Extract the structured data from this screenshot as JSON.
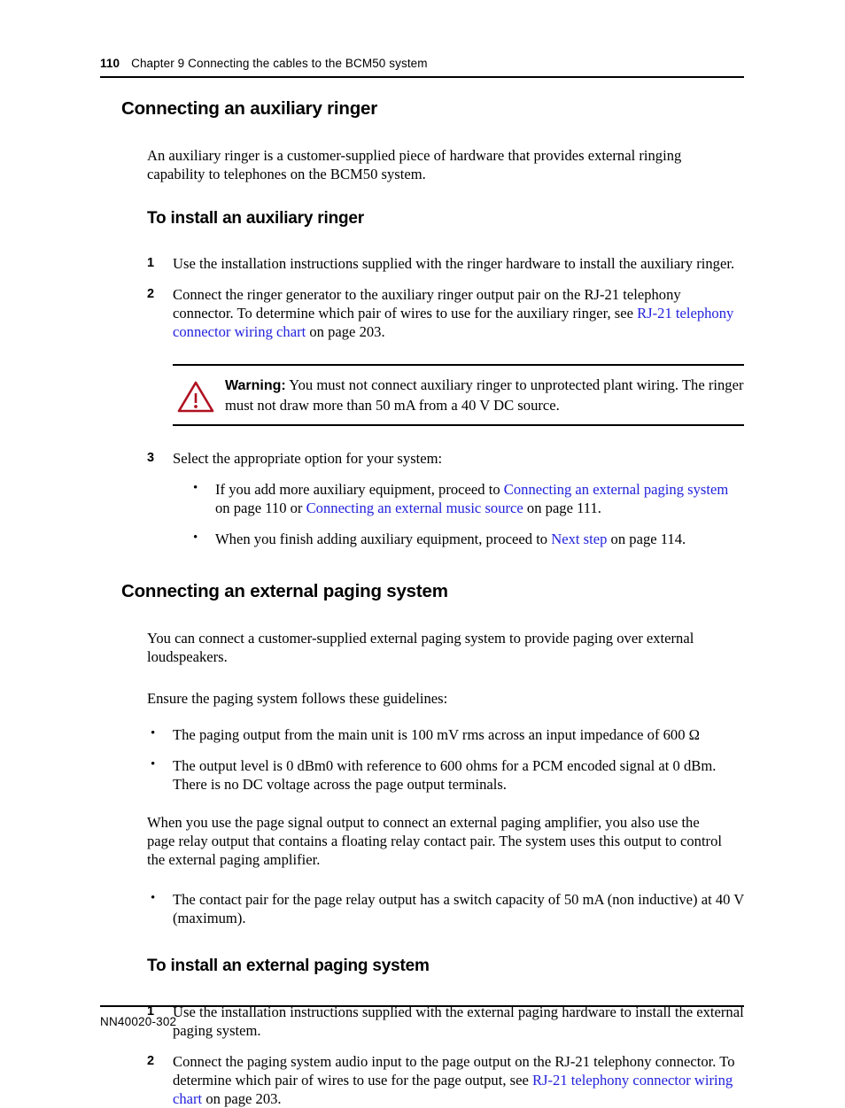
{
  "header": {
    "page_number": "110",
    "chapter_text": "Chapter 9  Connecting the cables to the BCM50 system"
  },
  "footer": {
    "document_code": "NN40020-302"
  },
  "colors": {
    "link": "#2222dd",
    "warning_icon": "#b01020",
    "text": "#000000"
  },
  "sections": {
    "aux_ringer": {
      "heading": "Connecting an auxiliary ringer",
      "intro": "An auxiliary ringer is a customer-supplied piece of hardware that provides external ringing capability to telephones on the BCM50 system.",
      "subheading": "To install an auxiliary ringer",
      "step1_num": "1",
      "step1_text": "Use the installation instructions supplied with the ringer hardware to install the auxiliary ringer.",
      "step2_num": "2",
      "step2_a": "Connect the ringer generator to the auxiliary ringer output pair on the RJ-21 telephony connector. To determine which pair of wires to use for the auxiliary ringer, see ",
      "step2_link": "RJ-21 telephony connector wiring chart",
      "step2_b": " on page 203.",
      "warning_label": "Warning:",
      "warning_text": " You must not connect auxiliary ringer to unprotected plant wiring. The ringer must not draw more than 50 mA from a 40 V DC source.",
      "warning_icon_name": "warning-triangle-icon",
      "step3_num": "3",
      "step3_text": "Select the appropriate option for your system:",
      "bullet1_a": "If you add more auxiliary equipment, proceed to ",
      "bullet1_link1": "Connecting an external paging system",
      "bullet1_b": " on page 110 or ",
      "bullet1_link2": "Connecting an external music source",
      "bullet1_c": " on page 111.",
      "bullet2_a": "When you finish adding auxiliary equipment, proceed to ",
      "bullet2_link": "Next step",
      "bullet2_b": " on page 114."
    },
    "paging": {
      "heading": "Connecting an external paging system",
      "intro": "You can connect a customer-supplied external paging system to provide paging over external loudspeakers.",
      "guidelines_lead": "Ensure the paging system follows these guidelines:",
      "bullet1": "The paging output from the main unit is 100 mV rms across an input impedance of 600 Ω",
      "bullet2": "The output level is 0 dBm0 with reference to 600 ohms for a PCM encoded signal at 0 dBm. There is no DC voltage across the page output terminals.",
      "relay_para": "When you use the page signal output to connect an external paging amplifier, you also use the page relay output that contains a floating relay contact pair. The system uses this output to control the external paging amplifier.",
      "bullet3": "The contact pair for the page relay output has a switch capacity of 50 mA (non inductive) at 40 V (maximum).",
      "subheading": "To install an external paging system",
      "step1_num": "1",
      "step1_text": "Use the installation instructions supplied with the external paging hardware to install the external paging system.",
      "step2_num": "2",
      "step2_a": "Connect the paging system audio input to the page output on the RJ-21 telephony connector. To determine which pair of wires to use for the page output, see ",
      "step2_link": "RJ-21 telephony connector wiring chart",
      "step2_b": " on page 203."
    }
  },
  "bullet_glyph": "•"
}
